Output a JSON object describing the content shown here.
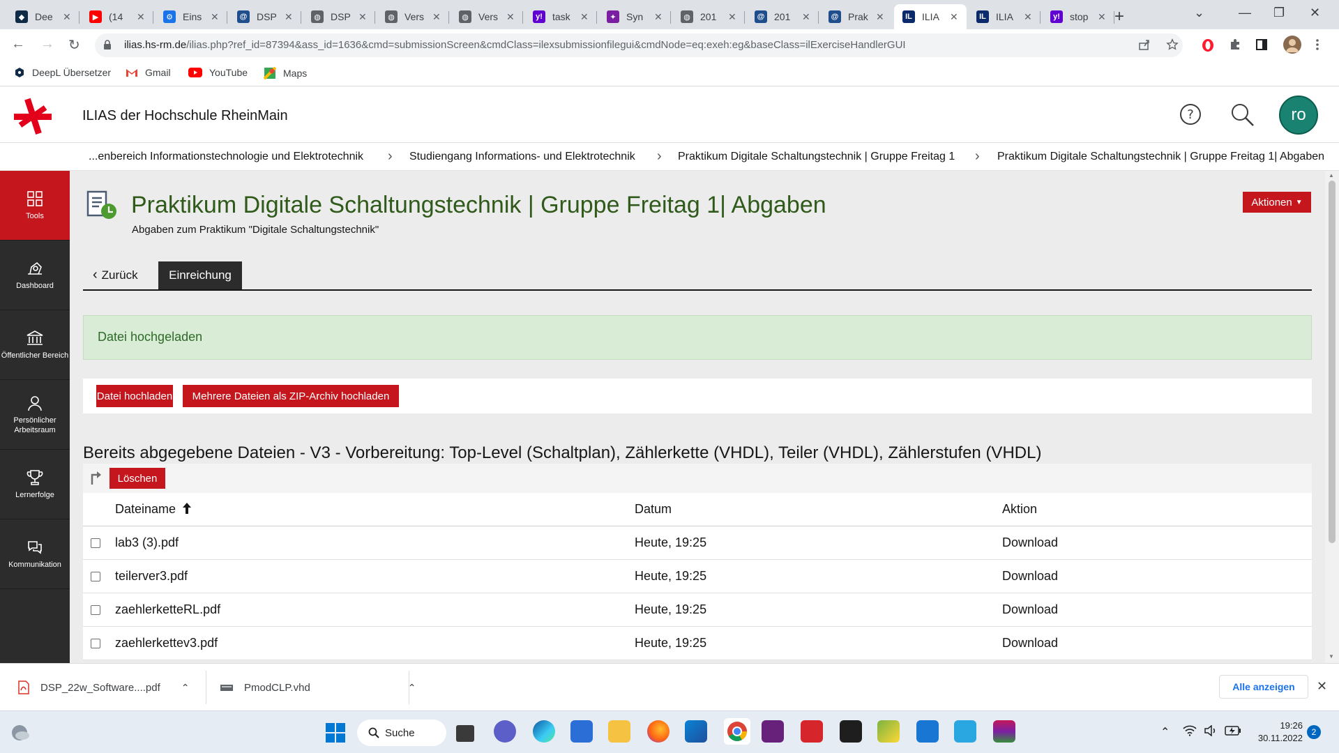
{
  "browser": {
    "tabs": [
      {
        "label": "Dee",
        "icon": "deepl-icon",
        "color": "#0f2b46"
      },
      {
        "label": "(14",
        "icon": "youtube-icon",
        "color": "#ff0000"
      },
      {
        "label": "Eins",
        "icon": "gear-icon",
        "color": "#1a73e8"
      },
      {
        "label": "DSP",
        "icon": "ilias-spiral-icon",
        "color": "#1f4e8c"
      },
      {
        "label": "DSP",
        "icon": "globe-icon",
        "color": "#5f6368"
      },
      {
        "label": "Vers",
        "icon": "globe-icon",
        "color": "#5f6368"
      },
      {
        "label": "Vers",
        "icon": "globe-icon",
        "color": "#5f6368"
      },
      {
        "label": "task",
        "icon": "yahoo-icon",
        "color": "#6001d2"
      },
      {
        "label": "Syn",
        "icon": "synopsys-icon",
        "color": "#7a1fa2"
      },
      {
        "label": "201",
        "icon": "globe-icon",
        "color": "#5f6368"
      },
      {
        "label": "201",
        "icon": "ilias-spiral-icon",
        "color": "#1f4e8c"
      },
      {
        "label": "Prak",
        "icon": "ilias-spiral-icon",
        "color": "#1f4e8c"
      },
      {
        "label": "ILIA",
        "icon": "ilias-logo-icon",
        "color": "#0a2a6b"
      },
      {
        "label": "ILIA",
        "icon": "ilias-logo-icon",
        "color": "#0a2a6b"
      },
      {
        "label": "stop",
        "icon": "yahoo-icon",
        "color": "#6001d2"
      }
    ],
    "active_tab_index": 12,
    "url_host": "ilias.hs-rm.de",
    "url_path": "/ilias.php?ref_id=87394&ass_id=1636&cmd=submissionScreen&cmdClass=ilexsubmissionfilegui&cmdNode=eq:exeh:eg&baseClass=ilExerciseHandlerGUI",
    "bookmarks": [
      {
        "label": "DeepL Übersetzer",
        "icon": "deepl-icon"
      },
      {
        "label": "Gmail",
        "icon": "gmail-icon"
      },
      {
        "label": "YouTube",
        "icon": "youtube-icon"
      },
      {
        "label": "Maps",
        "icon": "maps-icon"
      }
    ]
  },
  "header": {
    "site_title": "ILIAS der Hochschule RheinMain",
    "avatar_initials": "ro"
  },
  "breadcrumb": [
    "...enbereich Informationstechnologie und Elektrotechnik",
    "Studiengang Informations- und Elektrotechnik",
    "Praktikum Digitale Schaltungstechnik | Gruppe Freitag 1",
    "Praktikum Digitale Schaltungstechnik | Gruppe Freitag 1| Abgaben"
  ],
  "sidebar": {
    "items": [
      {
        "label": "Tools",
        "icon": "grid-icon"
      },
      {
        "label": "Dashboard",
        "icon": "dashboard-icon"
      },
      {
        "label": "Öffentlicher Bereich",
        "icon": "building-icon"
      },
      {
        "label": "Persönlicher Arbeitsraum",
        "icon": "person-icon"
      },
      {
        "label": "Lernerfolge",
        "icon": "trophy-icon"
      },
      {
        "label": "Kommunikation",
        "icon": "chat-icon"
      }
    ]
  },
  "page": {
    "title": "Praktikum Digitale Schaltungstechnik | Gruppe Freitag 1| Abgaben",
    "description": "Abgaben zum Praktikum \"Digitale Schaltungstechnik\"",
    "actions_label": "Aktionen",
    "tab_back": "Zurück",
    "tab_active": "Einreichung",
    "success_message": "Datei hochgeladen",
    "upload_button": "Datei hochladen",
    "upload_zip_button": "Mehrere Dateien als ZIP-Archiv hochladen",
    "section_title": "Bereits abgegebene Dateien - V3 - Vorbereitung: Top-Level (Schaltplan), Zählerkette (VHDL), Teiler (VHDL), Zählerstufen (VHDL)",
    "delete_button": "Löschen",
    "table": {
      "columns": [
        "Dateiname",
        "Datum",
        "Aktion"
      ],
      "rows": [
        {
          "name": "lab3 (3).pdf",
          "date": "Heute, 19:25",
          "action": "Download"
        },
        {
          "name": "teilerver3.pdf",
          "date": "Heute, 19:25",
          "action": "Download"
        },
        {
          "name": "zaehlerketteRL.pdf",
          "date": "Heute, 19:25",
          "action": "Download"
        },
        {
          "name": "zaehlerkettev3.pdf",
          "date": "Heute, 19:25",
          "action": "Download"
        }
      ]
    }
  },
  "downloads": {
    "items": [
      {
        "name": "DSP_22w_Software....pdf",
        "icon": "pdf-file-icon"
      },
      {
        "name": "PmodCLP.vhd",
        "icon": "file-icon"
      }
    ],
    "show_all": "Alle anzeigen"
  },
  "taskbar": {
    "search_label": "Suche",
    "time": "19:26",
    "date": "30.11.2022",
    "notification_count": "2"
  },
  "colors": {
    "ilias_red": "#c4161c",
    "title_green": "#2f5a1a",
    "success_bg": "#d9ecd5",
    "sidebar_bg": "#2c2c2c"
  }
}
